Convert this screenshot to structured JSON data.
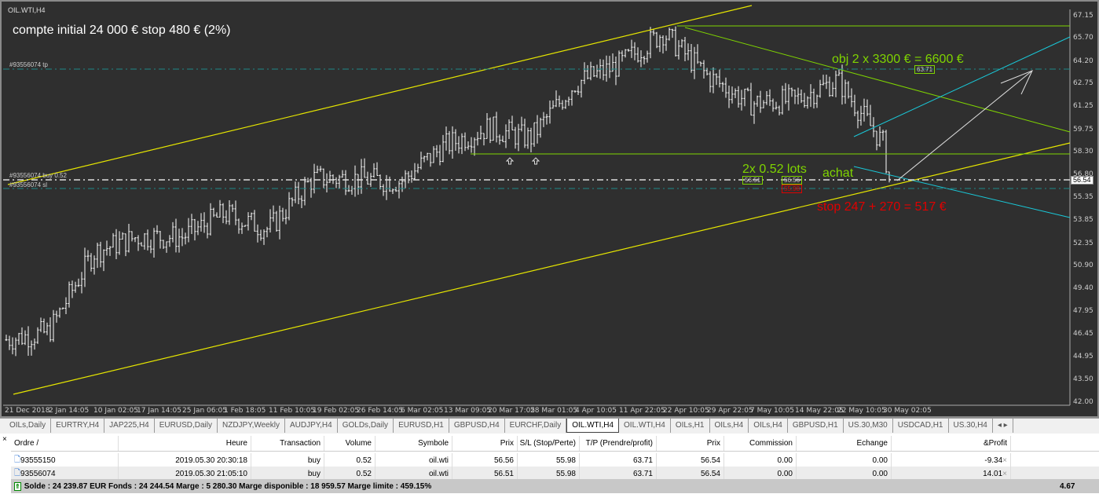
{
  "chart": {
    "symbol": "OIL.WTI,H4",
    "annotations": {
      "account": "compte initial 24 000 € stop 480 € (2%)",
      "target": "obj 2 x 3300 € = 6600 €",
      "lots": "2x 0.52 lots",
      "buy": "achat",
      "stop": "stop 247 + 270 = 517 €"
    },
    "order_labels": {
      "tp": "#93556074 tp",
      "buy": "#93556074 buy 0.52",
      "sl": "#93556074 sl"
    },
    "price_boxes": {
      "tp": "63.71",
      "open1": "56.51",
      "open2": "56.56",
      "sl": "55.98"
    },
    "current_price": "56.54",
    "colors": {
      "background": "#2f2f2f",
      "bars": "#ffffff",
      "channel": "#e6e600",
      "green": "#7fd400",
      "cyan": "#19c8d8",
      "stop": "#e00000"
    }
  },
  "chart_data": {
    "type": "ohlc",
    "title": "OIL.WTI,H4",
    "y_ticks": [
      "67.15",
      "65.70",
      "64.20",
      "62.75",
      "61.25",
      "59.75",
      "58.30",
      "56.80",
      "55.35",
      "53.85",
      "52.35",
      "50.90",
      "49.40",
      "47.95",
      "46.45",
      "44.95",
      "43.50",
      "42.00"
    ],
    "ylim": [
      42.0,
      67.15
    ],
    "x_ticks": [
      "21 Dec 2018",
      "2 Jan 14:05",
      "10 Jan 02:05",
      "17 Jan 14:05",
      "25 Jan 06:05",
      "1 Feb 18:05",
      "11 Feb 10:05",
      "19 Feb 02:05",
      "26 Feb 14:05",
      "6 Mar 02:05",
      "13 Mar 09:05",
      "20 Mar 17:05",
      "28 Mar 01:05",
      "4 Apr 10:05",
      "11 Apr 22:05",
      "22 Apr 10:05",
      "29 Apr 22:05",
      "7 May 10:05",
      "14 May 22:05",
      "22 May 10:05",
      "30 May 02:05"
    ],
    "approx_close_at_ticks": [
      46.1,
      46.6,
      51.8,
      52.8,
      52.8,
      54.3,
      53.3,
      56.6,
      56.6,
      56.4,
      58.7,
      59.9,
      59.2,
      62.8,
      64.0,
      66.1,
      63.3,
      61.5,
      61.7,
      63.0,
      58.9
    ],
    "last": 56.54
  },
  "tabs": [
    "OILs,Daily",
    "EURTRY,H4",
    "JAP225,H4",
    "EURUSD,Daily",
    "NZDJPY,Weekly",
    "AUDJPY,H4",
    "GOLDs,Daily",
    "EURUSD,H1",
    "GBPUSD,H4",
    "EURCHF,Daily",
    "OIL.WTI,H4",
    "OIL.WTI,H4",
    "OILs,H1",
    "OILs,H4",
    "OILs,H4",
    "GBPUSD,H1",
    "US.30,M30",
    "USDCAD,H1",
    "US.30,H4"
  ],
  "active_tab": 10,
  "terminal": {
    "headers": [
      "Ordre  /",
      "Heure",
      "Transaction",
      "Volume",
      "Symbole",
      "Prix",
      "S/L (Stop/Perte)",
      "T/P (Prendre/profit)",
      "Prix",
      "Commission",
      "Echange",
      "&Profit"
    ],
    "rows": [
      [
        "93555150",
        "2019.05.30 20:30:18",
        "buy",
        "0.52",
        "oil.wti",
        "56.56",
        "55.98",
        "63.71",
        "56.54",
        "0.00",
        "0.00",
        "-9.34"
      ],
      [
        "93556074",
        "2019.05.30 21:05:10",
        "buy",
        "0.52",
        "oil.wti",
        "56.51",
        "55.98",
        "63.71",
        "56.54",
        "0.00",
        "0.00",
        "14.01"
      ]
    ],
    "summary": "Solde : 24 239.87 EUR  Fonds : 24 244.54  Marge : 5 280.30  Marge disponible : 18 959.57  Marge limite : 459.15%",
    "total_profit": "4.67"
  }
}
